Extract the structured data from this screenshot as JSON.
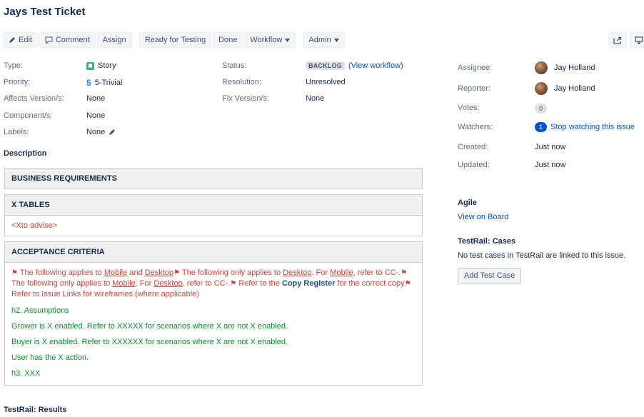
{
  "issue": {
    "title": "Jays Test Ticket"
  },
  "toolbar": {
    "edit": "Edit",
    "comment": "Comment",
    "assign": "Assign",
    "ready": "Ready for Testing",
    "done": "Done",
    "workflow": "Workflow",
    "admin": "Admin"
  },
  "details": {
    "type_label": "Type:",
    "type_value": "Story",
    "priority_label": "Priority:",
    "priority_value": "5-Trivial",
    "affects_label": "Affects Version/s:",
    "affects_value": "None",
    "components_label": "Component/s:",
    "components_value": "None",
    "labels_label": "Labels:",
    "labels_value": "None",
    "status_label": "Status:",
    "status_value": "BACKLOG",
    "view_workflow": "(View workflow)",
    "resolution_label": "Resolution:",
    "resolution_value": "Unresolved",
    "fix_label": "Fix Version/s:",
    "fix_value": "None"
  },
  "people": {
    "assignee_label": "Assignee:",
    "assignee_value": "Jay Holland",
    "reporter_label": "Reporter:",
    "reporter_value": "Jay Holland",
    "votes_label": "Votes:",
    "votes_value": "0",
    "watchers_label": "Watchers:",
    "watchers_value": "1",
    "stop_watching": "Stop watching this issue"
  },
  "dates": {
    "created_label": "Created:",
    "created_value": "Just now",
    "updated_label": "Updated:",
    "updated_value": "Just now"
  },
  "agile": {
    "title": "Agile",
    "link": "View on Board"
  },
  "testrail_cases": {
    "title": "TestRail: Cases",
    "text": "No test cases in TestRail are linked to this issue.",
    "button": "Add Test Case"
  },
  "description": {
    "title": "Description",
    "panels": {
      "business": "BUSINESS REQUIREMENTS",
      "xtables": "X TABLES",
      "xtables_body": "<Xto advise>",
      "acceptance": "ACCEPTANCE CRITERIA"
    },
    "acceptance": {
      "p1_a": " The following applies to ",
      "mobile": "Mobile",
      "and": " and ",
      "desktop": "Desktop",
      "p1_b": " The following only applies to ",
      "p1_c": ". For ",
      "p1_d": ", refer to CC-.",
      "p1_e": " The following only applies to ",
      "p1_f": ". For ",
      "p1_g": ", refer to CC-.",
      "p1_h": " Refer to the ",
      "copy_register": "Copy Register",
      "p1_i": " for the correct copy",
      "p1_j": " Refer to Issue Links for wireframes (where applicable)",
      "h2": "h2. Assumptions",
      "grower": "Grower is X enabled. Refer to XXXXX for scenarios where X are not X enabled.",
      "buyer": "Buyer is X enabled. Refer to XXXXXX for scenarios where X are not X enabled.",
      "user": "User has the X action.",
      "h3": "h3. XXX"
    }
  },
  "testrail_results": {
    "title": "TestRail: Results"
  },
  "colors": {
    "accent": "#0052cc",
    "story": "#36b37e",
    "red_text": "#d04437",
    "green_text": "#14892c"
  },
  "icons": [
    "pencil-icon",
    "comment-icon",
    "caret-down-icon",
    "share-icon",
    "export-icon",
    "story-icon",
    "priority-icon",
    "flag-icon"
  ]
}
